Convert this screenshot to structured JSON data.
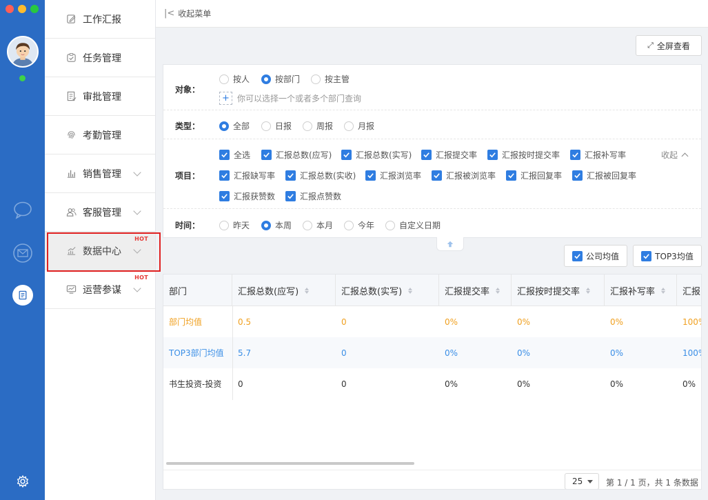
{
  "colors": {
    "rail_bg": "#2b6cc4",
    "accent": "#2f7de1",
    "avg_row": "#f0a020",
    "top3_row": "#3a8ee6",
    "hot_badge": "#e53935",
    "highlight_frame": "#e02020"
  },
  "rail": {
    "icons": [
      "chat-bubble-icon",
      "mail-icon",
      "document-icon",
      "settings-gear-icon"
    ]
  },
  "nav": {
    "items": [
      {
        "label": "工作汇报",
        "icon": "edit-icon",
        "expandable": false,
        "hot": ""
      },
      {
        "label": "任务管理",
        "icon": "task-check-icon",
        "expandable": false,
        "hot": ""
      },
      {
        "label": "审批管理",
        "icon": "approval-doc-icon",
        "expandable": false,
        "hot": ""
      },
      {
        "label": "考勤管理",
        "icon": "fingerprint-icon",
        "expandable": false,
        "hot": ""
      },
      {
        "label": "销售管理",
        "icon": "bar-chart-icon",
        "expandable": true,
        "hot": ""
      },
      {
        "label": "客服管理",
        "icon": "users-icon",
        "expandable": true,
        "hot": ""
      },
      {
        "label": "数据中心",
        "icon": "trend-chart-icon",
        "expandable": true,
        "hot": "HOT",
        "active": true
      },
      {
        "label": "运营参谋",
        "icon": "monitor-chart-icon",
        "expandable": true,
        "hot": "HOT"
      }
    ]
  },
  "topbar": {
    "collapse_label": "收起菜单"
  },
  "fullscreen": {
    "label": "全屏查看"
  },
  "filter": {
    "object": {
      "label": "对象：",
      "options": [
        "按人",
        "按部门",
        "按主管"
      ],
      "selected": "按部门",
      "hint": "你可以选择一个或者多个部门查询"
    },
    "type": {
      "label": "类型：",
      "options": [
        "全部",
        "日报",
        "周报",
        "月报"
      ],
      "selected": "全部"
    },
    "items": {
      "label": "项目：",
      "options": [
        "全选",
        "汇报总数(应写)",
        "汇报总数(实写)",
        "汇报提交率",
        "汇报按时提交率",
        "汇报补写率",
        "汇报缺写率",
        "汇报总数(实收)",
        "汇报浏览率",
        "汇报被浏览率",
        "汇报回复率",
        "汇报被回复率",
        "汇报获赞数",
        "汇报点赞数"
      ],
      "collapse_label": "收起"
    },
    "time": {
      "label": "时间：",
      "options": [
        "昨天",
        "本周",
        "本月",
        "今年",
        "自定义日期"
      ],
      "selected": "本周"
    }
  },
  "toggles": [
    {
      "label": "公司均值",
      "checked": true
    },
    {
      "label": "TOP3均值",
      "checked": true
    }
  ],
  "table": {
    "columns": [
      "部门",
      "汇报总数(应写)",
      "汇报总数(实写)",
      "汇报提交率",
      "汇报按时提交率",
      "汇报补写率",
      "汇报"
    ],
    "rows": [
      {
        "kind": "avg",
        "cells": [
          "部门均值",
          "0.5",
          "0",
          "0%",
          "0%",
          "0%",
          "100%"
        ]
      },
      {
        "kind": "top3",
        "cells": [
          "TOP3部门均值",
          "5.7",
          "0",
          "0%",
          "0%",
          "0%",
          "100%"
        ]
      },
      {
        "kind": "normal",
        "cells": [
          "书生投资-投资",
          "0",
          "0",
          "0%",
          "0%",
          "0%",
          "0%"
        ]
      }
    ]
  },
  "pager": {
    "page_size": "25",
    "info": "第 1 / 1 页，共 1 条数据"
  }
}
